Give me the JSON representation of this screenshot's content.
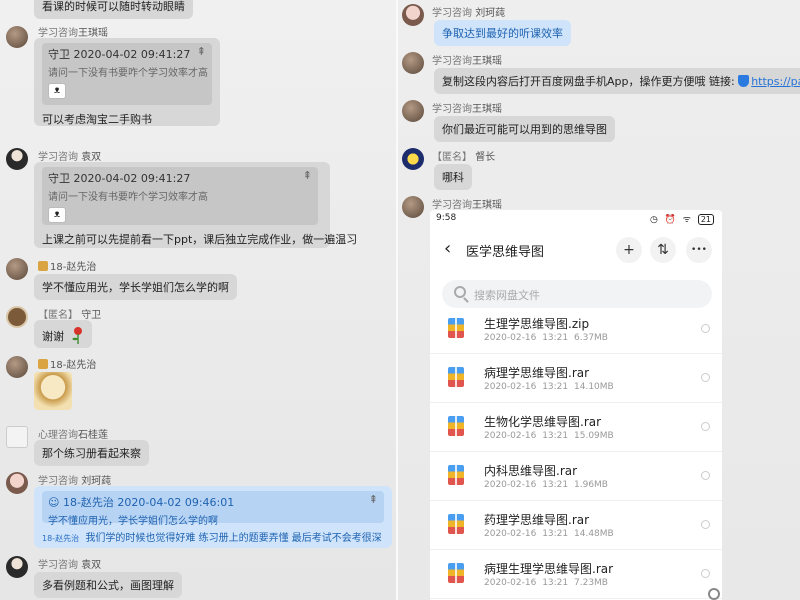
{
  "left_pane": {
    "top_bubble": "看课的时候可以随时转动眼睛",
    "messages": [
      {
        "sender_title": "学习咨询",
        "sender_name": "王琪瑶",
        "quote_head": "守卫  2020-04-02 09:41:27",
        "quote_body": "请问一下没有书要咋个学习效率才高",
        "text": "可以考虑淘宝二手购书"
      },
      {
        "sender_title": "学习咨询",
        "sender_name": "袁双",
        "quote_head": "守卫  2020-04-02 09:41:27",
        "quote_body": "请问一下没有书要咋个学习效率才高",
        "text": "上课之前可以先提前看一下ppt，课后独立完成作业，做一遍温习"
      },
      {
        "sender_name": "18-赵先治",
        "text": "学不懂应用光，学长学姐们怎么学的啊"
      },
      {
        "sender_title": "【匿名】",
        "sender_name": "守卫",
        "text": "谢谢"
      },
      {
        "sender_name": "18-赵先治"
      },
      {
        "sender_title": "心理咨询",
        "sender_name": "石桂莲",
        "text": "那个练习册看起来察"
      },
      {
        "sender_title": "学习咨询",
        "sender_name": "刘珂莼",
        "quote_head": "18-赵先治  2020-04-02 09:46:01",
        "quote_body": "学不懂应用光，学长学姐们怎么学的啊",
        "mention_tag": "18-赵先治",
        "text": "我们学的时候也觉得好难 练习册上的题要弄懂 最后考试不会考很深"
      },
      {
        "sender_title": "学习咨询",
        "sender_name": "袁双",
        "text": "多看例题和公式，画图理解"
      }
    ]
  },
  "right_pane": {
    "messages": [
      {
        "sender_title": "学习咨询",
        "sender_name": "刘珂莼",
        "text": "争取达到最好的听课效率"
      },
      {
        "sender_title": "学习咨询",
        "sender_name": "王琪瑶",
        "text": "复制这段内容后打开百度网盘手机App，操作更方便哦 链接:",
        "link": "https://pan.baidu.com"
      },
      {
        "sender_title": "学习咨询",
        "sender_name": "王琪瑶",
        "text": "你们最近可能可以用到的思维导图"
      },
      {
        "sender_title": "【匿名】",
        "sender_name": "督长",
        "text": "哪科"
      },
      {
        "sender_title": "学习咨询",
        "sender_name": "王琪瑶"
      }
    ],
    "phone": {
      "time": "9:58",
      "status_icons": "◷ ⏰ ᯤ",
      "battery": "21",
      "back_icon": "‹",
      "title": "医学思维导图",
      "add_icon": "+",
      "sort_icon": "⇅",
      "more_icon": "•••",
      "search_placeholder": "搜索网盘文件",
      "files": [
        {
          "name": "生理学思维导图.zip",
          "date": "2020-02-16",
          "time": "13:21",
          "size": "6.37MB"
        },
        {
          "name": "病理学思维导图.rar",
          "date": "2020-02-16",
          "time": "13:21",
          "size": "14.10MB"
        },
        {
          "name": "生物化学思维导图.rar",
          "date": "2020-02-16",
          "time": "13:21",
          "size": "15.09MB"
        },
        {
          "name": "内科思维导图.rar",
          "date": "2020-02-16",
          "time": "13:21",
          "size": "1.96MB"
        },
        {
          "name": "药理学思维导图.rar",
          "date": "2020-02-16",
          "time": "13:21",
          "size": "14.48MB"
        },
        {
          "name": "病理生理学思维导图.rar",
          "date": "2020-02-16",
          "time": "13:21",
          "size": "7.23MB"
        }
      ]
    }
  }
}
